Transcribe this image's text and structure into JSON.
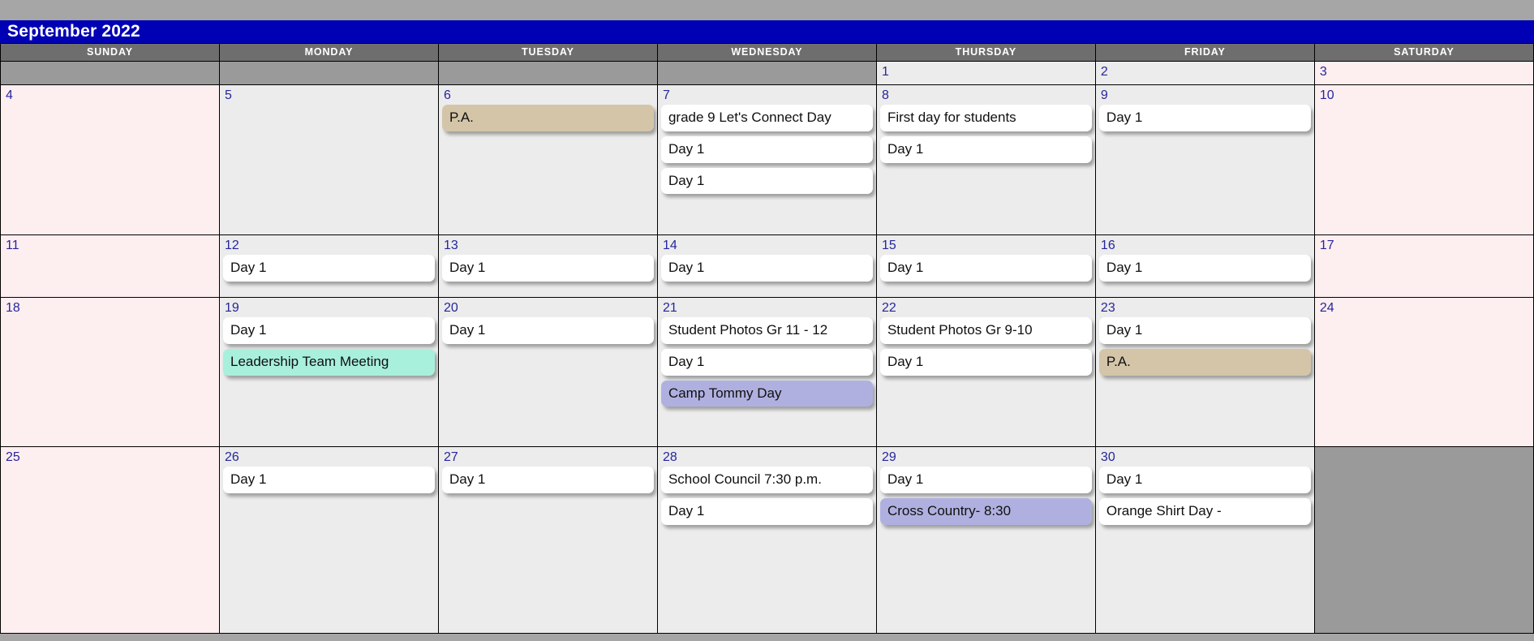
{
  "header": {
    "month_title": "September 2022"
  },
  "weekdays": [
    "SUNDAY",
    "MONDAY",
    "TUESDAY",
    "WEDNESDAY",
    "THURSDAY",
    "FRIDAY",
    "SATURDAY"
  ],
  "colors": {
    "page_background": "#a6a6a6",
    "title_bar": "#0000b4",
    "title_text": "#ffffff",
    "weekday_header": "#6e6e6e",
    "weekday_cell": "#ececec",
    "weekend_cell": "#fdeef0",
    "blank_cell": "#9a9a9a",
    "date_number": "#26269c",
    "event_default": "#ffffff",
    "event_tan": "#d4c5a9",
    "event_teal": "#a8f0dc",
    "event_periwinkle": "#b0b0e0"
  },
  "weeks": [
    {
      "row": 1,
      "days": [
        {
          "date": "",
          "blank": true,
          "weekend": true,
          "events": []
        },
        {
          "date": "",
          "blank": true,
          "weekend": false,
          "events": []
        },
        {
          "date": "",
          "blank": true,
          "weekend": false,
          "events": []
        },
        {
          "date": "",
          "blank": true,
          "weekend": false,
          "events": []
        },
        {
          "date": "1",
          "blank": false,
          "weekend": false,
          "events": []
        },
        {
          "date": "2",
          "blank": false,
          "weekend": false,
          "events": []
        },
        {
          "date": "3",
          "blank": false,
          "weekend": true,
          "events": []
        }
      ]
    },
    {
      "row": 2,
      "days": [
        {
          "date": "4",
          "blank": false,
          "weekend": true,
          "events": []
        },
        {
          "date": "5",
          "blank": false,
          "weekend": false,
          "events": []
        },
        {
          "date": "6",
          "blank": false,
          "weekend": false,
          "events": [
            {
              "label": "P.A.",
              "color": "tan"
            }
          ]
        },
        {
          "date": "7",
          "blank": false,
          "weekend": false,
          "events": [
            {
              "label": "grade 9 Let's Connect Day",
              "color": "default"
            },
            {
              "label": "Day 1",
              "color": "default"
            },
            {
              "label": "Day 1",
              "color": "default"
            }
          ]
        },
        {
          "date": "8",
          "blank": false,
          "weekend": false,
          "events": [
            {
              "label": "First day for students",
              "color": "default"
            },
            {
              "label": "Day 1",
              "color": "default"
            }
          ]
        },
        {
          "date": "9",
          "blank": false,
          "weekend": false,
          "events": [
            {
              "label": "Day 1",
              "color": "default"
            }
          ]
        },
        {
          "date": "10",
          "blank": false,
          "weekend": true,
          "events": []
        }
      ]
    },
    {
      "row": 3,
      "days": [
        {
          "date": "11",
          "blank": false,
          "weekend": true,
          "events": []
        },
        {
          "date": "12",
          "blank": false,
          "weekend": false,
          "events": [
            {
              "label": "Day 1",
              "color": "default"
            }
          ]
        },
        {
          "date": "13",
          "blank": false,
          "weekend": false,
          "events": [
            {
              "label": "Day 1",
              "color": "default"
            }
          ]
        },
        {
          "date": "14",
          "blank": false,
          "weekend": false,
          "events": [
            {
              "label": "Day 1",
              "color": "default"
            }
          ]
        },
        {
          "date": "15",
          "blank": false,
          "weekend": false,
          "events": [
            {
              "label": "Day 1",
              "color": "default"
            }
          ]
        },
        {
          "date": "16",
          "blank": false,
          "weekend": false,
          "events": [
            {
              "label": "Day 1",
              "color": "default"
            }
          ]
        },
        {
          "date": "17",
          "blank": false,
          "weekend": true,
          "events": []
        }
      ]
    },
    {
      "row": 4,
      "days": [
        {
          "date": "18",
          "blank": false,
          "weekend": true,
          "events": []
        },
        {
          "date": "19",
          "blank": false,
          "weekend": false,
          "events": [
            {
              "label": "Day 1",
              "color": "default"
            },
            {
              "label": "Leadership Team Meeting",
              "color": "teal"
            }
          ]
        },
        {
          "date": "20",
          "blank": false,
          "weekend": false,
          "events": [
            {
              "label": "Day 1",
              "color": "default"
            }
          ]
        },
        {
          "date": "21",
          "blank": false,
          "weekend": false,
          "events": [
            {
              "label": "Student Photos Gr 11 - 12",
              "color": "default"
            },
            {
              "label": "Day 1",
              "color": "default"
            },
            {
              "label": "Camp Tommy Day",
              "color": "periwinkle"
            }
          ]
        },
        {
          "date": "22",
          "blank": false,
          "weekend": false,
          "events": [
            {
              "label": "Student Photos Gr 9-10",
              "color": "default"
            },
            {
              "label": "Day 1",
              "color": "default"
            }
          ]
        },
        {
          "date": "23",
          "blank": false,
          "weekend": false,
          "events": [
            {
              "label": "Day 1",
              "color": "default"
            },
            {
              "label": "P.A.",
              "color": "tan"
            }
          ]
        },
        {
          "date": "24",
          "blank": false,
          "weekend": true,
          "events": []
        }
      ]
    },
    {
      "row": 5,
      "days": [
        {
          "date": "25",
          "blank": false,
          "weekend": true,
          "events": []
        },
        {
          "date": "26",
          "blank": false,
          "weekend": false,
          "events": [
            {
              "label": "Day 1",
              "color": "default"
            }
          ]
        },
        {
          "date": "27",
          "blank": false,
          "weekend": false,
          "events": [
            {
              "label": "Day 1",
              "color": "default"
            }
          ]
        },
        {
          "date": "28",
          "blank": false,
          "weekend": false,
          "events": [
            {
              "label": "School Council 7:30 p.m.",
              "color": "default"
            },
            {
              "label": "Day 1",
              "color": "default"
            }
          ]
        },
        {
          "date": "29",
          "blank": false,
          "weekend": false,
          "events": [
            {
              "label": "Day 1",
              "color": "default"
            },
            {
              "label": "Cross Country- 8:30",
              "color": "periwinkle"
            }
          ]
        },
        {
          "date": "30",
          "blank": false,
          "weekend": false,
          "events": [
            {
              "label": "Day 1",
              "color": "default"
            },
            {
              "label": "Orange Shirt Day -",
              "color": "default"
            }
          ]
        },
        {
          "date": "",
          "blank": true,
          "weekend": true,
          "events": []
        }
      ]
    }
  ]
}
